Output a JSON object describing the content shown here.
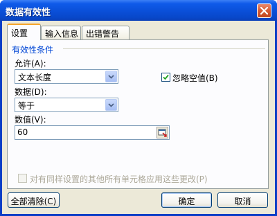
{
  "dialog": {
    "title": "数据有效性"
  },
  "tabs": [
    {
      "label": "设置"
    },
    {
      "label": "输入信息"
    },
    {
      "label": "出错警告"
    }
  ],
  "settings": {
    "group_title": "有效性条件",
    "allow_label": "允许(A):",
    "allow_value": "文本长度",
    "ignore_blank_label": "忽略空值(B)",
    "ignore_blank_checked": true,
    "data_label": "数据(D):",
    "data_value": "等于",
    "value_label": "数值(V):",
    "value_input": "60",
    "apply_all_label": "对有同样设置的其他所有单元格应用这些更改(P)",
    "apply_all_checked": false
  },
  "buttons": {
    "clear_all": "全部清除(C)",
    "ok": "确定",
    "cancel": "取消"
  }
}
